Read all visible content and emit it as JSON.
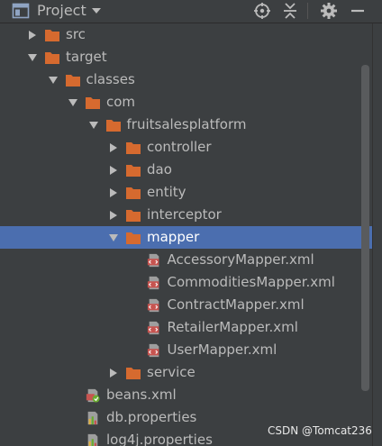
{
  "header": {
    "title": "Project",
    "icons": {
      "project": "project-icon",
      "dropdown": "chevron-down-icon",
      "locate": "crosshair-icon",
      "collapse": "collapse-all-icon",
      "settings": "gear-icon",
      "hide": "minimize-icon"
    }
  },
  "colors": {
    "background": "#3c3f41",
    "selection": "#4b6eaf",
    "folder": "#d66a2f",
    "text": "#bbbbbb"
  },
  "tree": {
    "items": [
      {
        "label": "src",
        "expanded": false,
        "type": "folder"
      },
      {
        "label": "target",
        "expanded": true,
        "type": "folder"
      },
      {
        "label": "classes",
        "expanded": true,
        "type": "folder"
      },
      {
        "label": "com",
        "expanded": true,
        "type": "folder"
      },
      {
        "label": "fruitsalesplatform",
        "expanded": true,
        "type": "folder"
      },
      {
        "label": "controller",
        "expanded": false,
        "type": "folder"
      },
      {
        "label": "dao",
        "expanded": false,
        "type": "folder"
      },
      {
        "label": "entity",
        "expanded": false,
        "type": "folder"
      },
      {
        "label": "interceptor",
        "expanded": false,
        "type": "folder"
      },
      {
        "label": "mapper",
        "expanded": true,
        "type": "folder",
        "selected": true
      },
      {
        "label": "AccessoryMapper.xml",
        "type": "xml"
      },
      {
        "label": "CommoditiesMapper.xml",
        "type": "xml"
      },
      {
        "label": "ContractMapper.xml",
        "type": "xml"
      },
      {
        "label": "RetailerMapper.xml",
        "type": "xml"
      },
      {
        "label": "UserMapper.xml",
        "type": "xml"
      },
      {
        "label": "service",
        "expanded": false,
        "type": "folder"
      },
      {
        "label": "beans.xml",
        "type": "spring-xml"
      },
      {
        "label": "db.properties",
        "type": "properties"
      },
      {
        "label": "log4j.properties",
        "type": "properties"
      }
    ]
  },
  "watermark": "CSDN @Tomcat236"
}
